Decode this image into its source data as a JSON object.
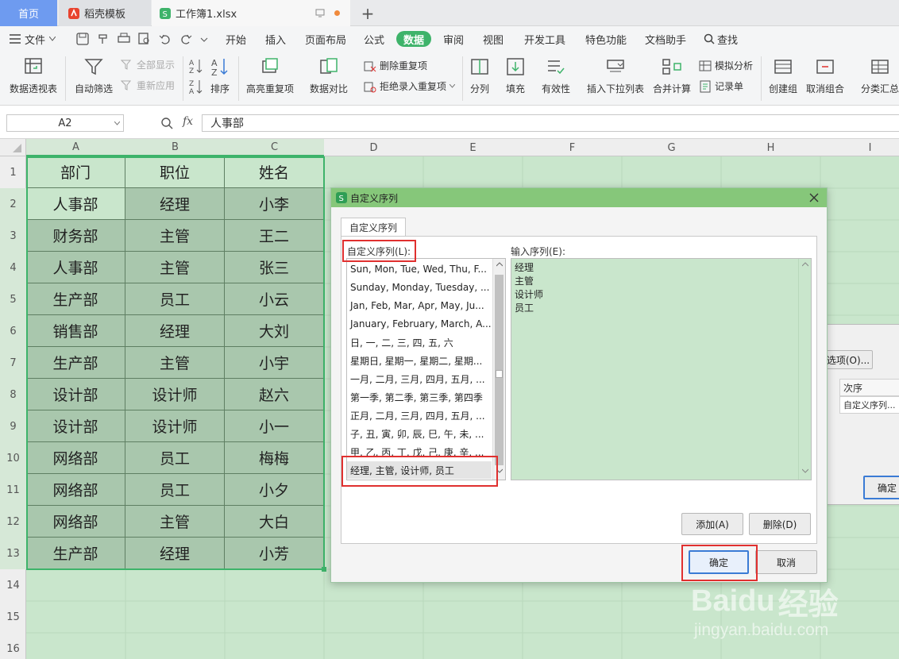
{
  "tabs": {
    "home": "首页",
    "daoke": "稻壳模板",
    "workbook": "工作簿1.xlsx"
  },
  "menu": {
    "file": "文件",
    "items": [
      "开始",
      "插入",
      "页面布局",
      "公式",
      "数据",
      "审阅",
      "视图",
      "开发工具",
      "特色功能",
      "文档助手"
    ],
    "active": "数据",
    "search": "查找"
  },
  "ribbon": {
    "pivot": "数据透视表",
    "autofilter": "自动筛选",
    "show_all": "全部显示",
    "reapply": "重新应用",
    "sort": "排序",
    "highlight_dup": "高亮重复项",
    "compare": "数据对比",
    "remove_dup": "删除重复项",
    "reject_dup": "拒绝录入重复项",
    "split": "分列",
    "fill": "填充",
    "validity": "有效性",
    "dropdown": "插入下拉列表",
    "consolidate": "合并计算",
    "simulate": "模拟分析",
    "record": "记录单",
    "create_group": "创建组",
    "ungroup": "取消组合",
    "subtotal": "分类汇总"
  },
  "formula_bar": {
    "name_box": "A2",
    "fx": "fx",
    "value": "人事部"
  },
  "columns": [
    "A",
    "B",
    "C",
    "D",
    "E",
    "F",
    "G",
    "H",
    "I"
  ],
  "rows": [
    "1",
    "2",
    "3",
    "4",
    "5",
    "6",
    "7",
    "8",
    "9",
    "10",
    "11",
    "12",
    "13",
    "14",
    "15",
    "16"
  ],
  "table": [
    [
      "部门",
      "职位",
      "姓名"
    ],
    [
      "人事部",
      "经理",
      "小李"
    ],
    [
      "财务部",
      "主管",
      "王二"
    ],
    [
      "人事部",
      "主管",
      "张三"
    ],
    [
      "生产部",
      "员工",
      "小云"
    ],
    [
      "销售部",
      "经理",
      "大刘"
    ],
    [
      "生产部",
      "主管",
      "小宇"
    ],
    [
      "设计部",
      "设计师",
      "赵六"
    ],
    [
      "设计部",
      "设计师",
      "小一"
    ],
    [
      "网络部",
      "员工",
      "梅梅"
    ],
    [
      "网络部",
      "员工",
      "小夕"
    ],
    [
      "网络部",
      "主管",
      "大白"
    ],
    [
      "生产部",
      "经理",
      "小芳"
    ]
  ],
  "dialog": {
    "title": "自定义序列",
    "tab": "自定义序列",
    "list_label": "自定义序列(L):",
    "entry_label": "输入序列(E):",
    "list_items": [
      "Sun, Mon, Tue, Wed, Thu, F...",
      "Sunday, Monday, Tuesday, ...",
      "Jan, Feb, Mar, Apr, May, Ju...",
      "January, February, March, A...",
      "日, 一, 二, 三, 四, 五, 六",
      "星期日, 星期一, 星期二, 星期...",
      "一月, 二月, 三月, 四月, 五月, ...",
      "第一季, 第二季, 第三季, 第四季",
      "正月, 二月, 三月, 四月, 五月, ...",
      "子, 丑, 寅, 卯, 辰, 巳, 午, 未, ...",
      "甲, 乙, 丙, 丁, 戊, 己, 庚, 辛, ...",
      "经理, 主管, 设计师, 员工"
    ],
    "entries": [
      "经理",
      "主管",
      "设计师",
      "员工"
    ],
    "add": "添加(A)",
    "delete": "删除(D)",
    "ok": "确定",
    "cancel": "取消"
  },
  "back_dialog": {
    "options": "选项(O)...",
    "order_header": "次序",
    "order_value": "自定义序列...",
    "ok": "确定"
  },
  "watermark": {
    "brand": "Baidu",
    "suffix": "经验",
    "url": "jingyan.baidu.com"
  },
  "colors": {
    "accent": "#3eb36a",
    "highlight": "#e0302f",
    "sheet_bg": "#c9e6cc"
  }
}
